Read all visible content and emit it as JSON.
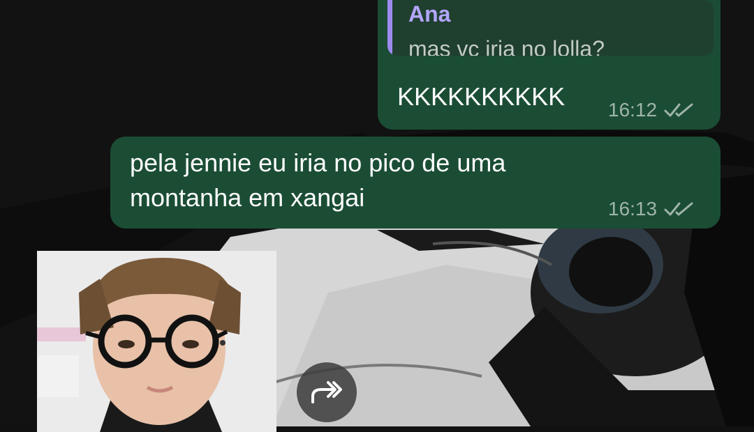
{
  "chat": {
    "messages": [
      {
        "reply": {
          "author": "Ana",
          "text": "mas vc iria no lolla?"
        },
        "text": "KKKKKKKKKK",
        "time": "16:12",
        "status_icon": "double-check-icon"
      },
      {
        "text_line1": "pela jennie eu iria no pico de uma",
        "text_line2": "montanha em xangai",
        "time": "16:13",
        "status_icon": "double-check-icon"
      }
    ],
    "photo_message": {
      "icon": "forward-icon"
    }
  },
  "colors": {
    "bubble": "#1b4d35",
    "reply_accent": "#9d8bf0",
    "reply_author": "#b3a6ff",
    "meta_text": "#9fb4a8"
  }
}
